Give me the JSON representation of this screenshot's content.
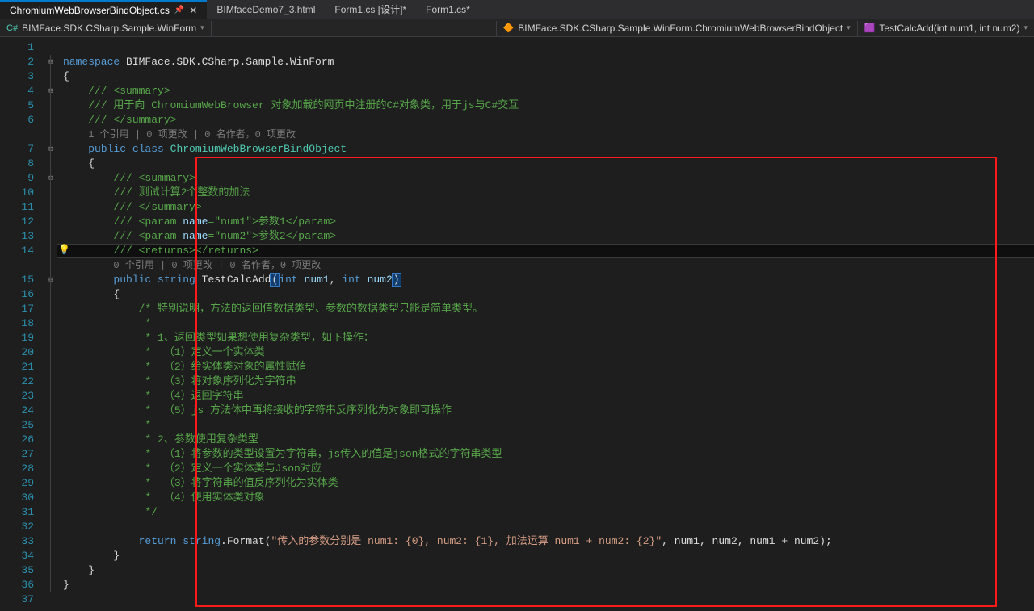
{
  "tabs": [
    {
      "label": "ChromiumWebBrowserBindObject.cs",
      "active": true,
      "pinned": true
    },
    {
      "label": "BIMfaceDemo7_3.html",
      "active": false
    },
    {
      "label": "Form1.cs [设计]*",
      "active": false
    },
    {
      "label": "Form1.cs*",
      "active": false
    }
  ],
  "nav": {
    "left": "BIMFace.SDK.CSharp.Sample.WinForm",
    "mid": "BIMFace.SDK.CSharp.Sample.WinForm.ChromiumWebBrowserBindObject",
    "right": "TestCalcAdd(int num1, int num2)"
  },
  "lines": {
    "l1": "1",
    "l2": "2",
    "l3": "3",
    "l4": "4",
    "l5": "5",
    "l6": "6",
    "l7": "7",
    "l8": "8",
    "l9": "9",
    "l10": "10",
    "l11": "11",
    "l12": "12",
    "l13": "13",
    "l14": "14",
    "l15": "15",
    "l16": "16",
    "l17": "17",
    "l18": "18",
    "l19": "19",
    "l20": "20",
    "l21": "21",
    "l22": "22",
    "l23": "23",
    "l24": "24",
    "l25": "25",
    "l26": "26",
    "l27": "27",
    "l28": "28",
    "l29": "29",
    "l30": "30",
    "l31": "31",
    "l32": "32",
    "l33": "33",
    "l34": "34",
    "l35": "35",
    "l36": "36",
    "l37": "37"
  },
  "tok": {
    "ns": "namespace",
    "nsname": " BIMFace.SDK.CSharp.Sample.WinForm",
    "ob": "{",
    "cb": "}",
    "cm_s": "/// <summary>",
    "cm_body": "/// 用于向 ChromiumWebBrowser 对象加载的网页中注册的C#对象类，用于js与C#交互",
    "cm_se": "/// </summary>",
    "ref1": "1 个引用 | 0 项更改 | 0 名作者，0 项更改",
    "pub": "public",
    "cls": " class ",
    "clname": "ChromiumWebBrowserBindObject",
    "cm2_s": "/// <summary>",
    "cm2_b": "/// 测试计算2个整数的加法",
    "cm2_e": "/// </summary>",
    "cm_p1a": "/// <param ",
    "cm_p1b": "name",
    "cm_p1c": "=",
    "cm_p1d": "\"num1\"",
    "cm_p1e": ">参数1</param>",
    "cm_p2a": "/// <param ",
    "cm_p2b": "name",
    "cm_p2c": "=",
    "cm_p2d": "\"num2\"",
    "cm_p2e": ">参数2</param>",
    "cm_ret": "/// <returns></returns>",
    "ref2": "0 个引用 | 0 项更改 | 0 名作者，0 项更改",
    "str": " string ",
    "meth": "TestCalcAdd",
    "lp": "(",
    "intk": "int",
    "sp": " ",
    "n1": "num1",
    "cm": ", ",
    "n2": "num2",
    "rp": ")",
    "c17": "/* 特别说明，方法的返回值数据类型、参数的数据类型只能是简单类型。",
    "c18": " *",
    "c19": " * 1、返回类型如果想使用复杂类型，如下操作：",
    "c20": " *  （1）定义一个实体类",
    "c21": " *  （2）给实体类对象的属性赋值",
    "c22": " *  （3）将对象序列化为字符串",
    "c23": " *  （4）返回字符串",
    "c24": " *  （5）js 方法体中再将接收的字符串反序列化为对象即可操作",
    "c25": " *",
    "c26": " * 2、参数使用复杂类型",
    "c27": " *  （1）将参数的类型设置为字符串，js传入的值是json格式的字符串类型",
    "c28": " *  （2）定义一个实体类与Json对应",
    "c29": " *  （3）将字符串的值反序列化为实体类",
    "c30": " *  （4）使用实体类对象",
    "c31": " */",
    "ret": "return",
    "strt": " string",
    "dot": ".",
    "fmt": "Format",
    "lp2": "(",
    "strlit": "\"传入的参数分别是 num1: {0}, num2: {1}, 加法运算 num1 + num2: {2}\"",
    "args": ", num1, num2, num1 + num2);"
  },
  "fold": {
    "box": "⊟"
  }
}
